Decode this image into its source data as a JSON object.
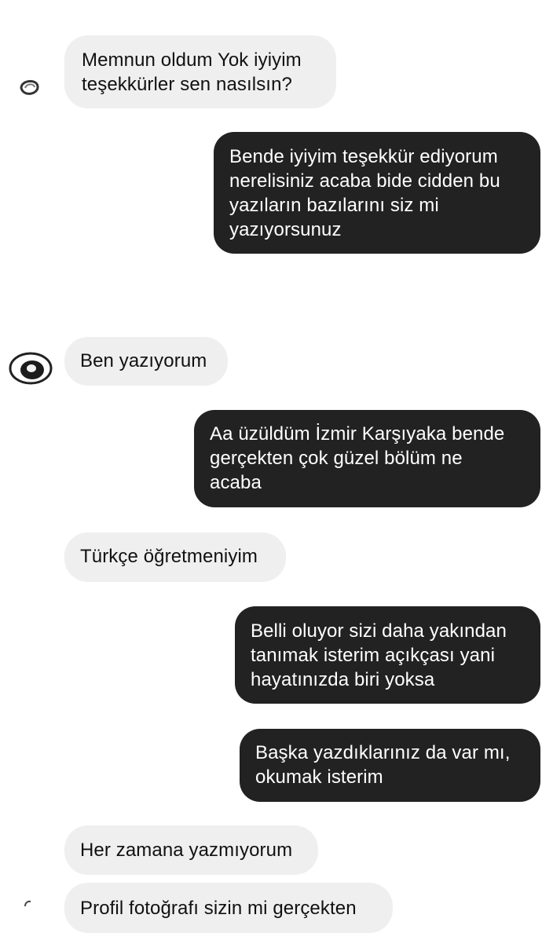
{
  "messages": [
    {
      "side": "in",
      "text": "Memnun oldum Yok iyiyim\nteşekkürler sen nasılsın?"
    },
    {
      "side": "out",
      "text": "Bende iyiyim teşekkür ediyorum\nnerelisiniz acaba bide cidden bu\nyazıların bazılarını siz mi\nyazıyorsunuz"
    },
    {
      "side": "in",
      "text": "Ben yazıyorum"
    },
    {
      "side": "out",
      "text": "Aa üzüldüm İzmir Karşıyaka bende\ngerçekten çok güzel bölüm ne\nacaba"
    },
    {
      "side": "in",
      "text": "Türkçe öğretmeniyim"
    },
    {
      "side": "out",
      "text": "Belli oluyor sizi daha yakından\ntanımak isterim açıkçası yani\nhayatınızda biri yoksa"
    },
    {
      "side": "out",
      "text": "Başka yazdıklarınız da var mı,\nokumak isterim"
    },
    {
      "side": "in",
      "text": "Her zamana yazmıyorum"
    },
    {
      "side": "in",
      "text": "Profil fotoğrafı sizin mi gerçekten"
    }
  ],
  "colors": {
    "incoming_bubble": "#efefef",
    "outgoing_bubble": "#222222",
    "incoming_text": "#111111",
    "outgoing_text": "#ffffff"
  },
  "icons": [
    "contact-avatar-icon"
  ]
}
